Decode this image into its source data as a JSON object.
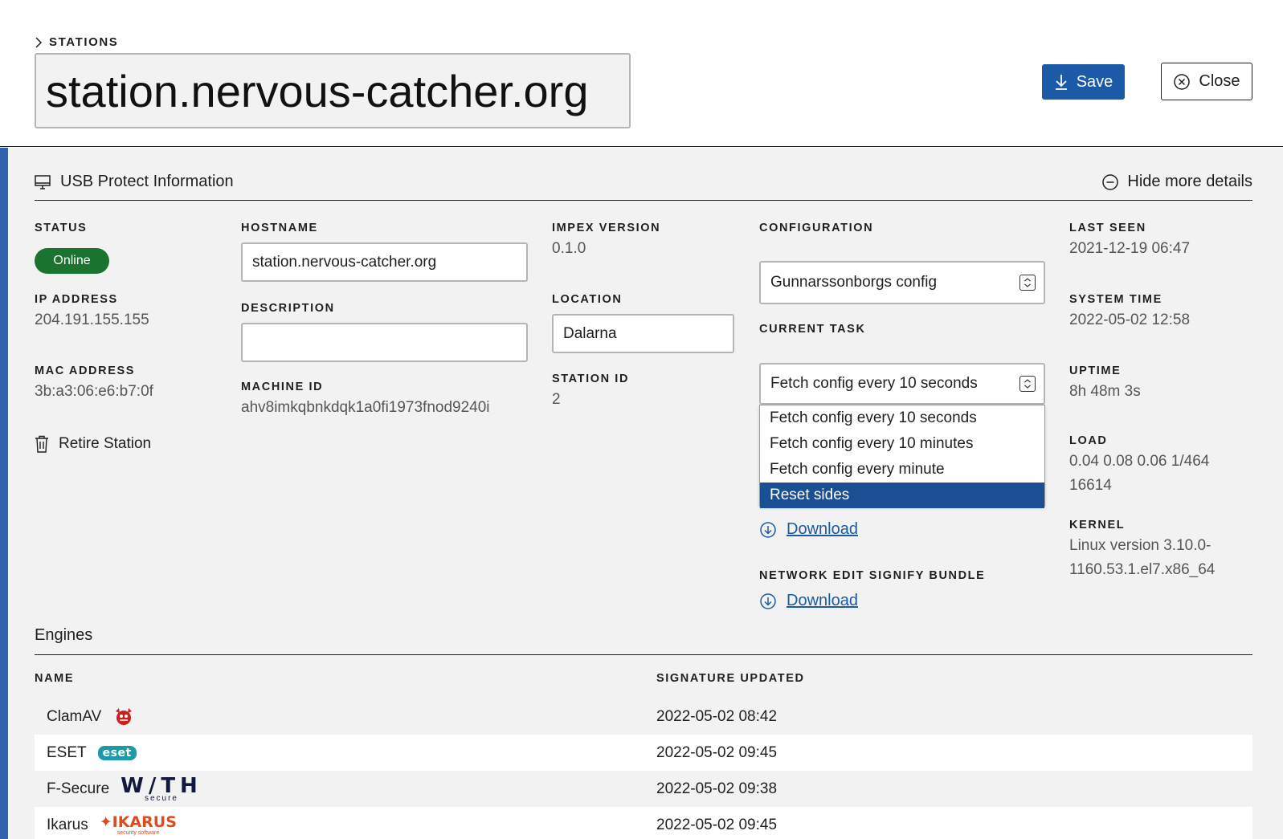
{
  "header": {
    "breadcrumb": "STATIONS",
    "title_value": "station.nervous-catcher.org",
    "save_label": "Save",
    "close_label": "Close"
  },
  "info": {
    "section_title": "USB Protect Information",
    "hide_details_label": "Hide more details",
    "status_label": "STATUS",
    "status_value": "Online",
    "ip_label": "IP ADDRESS",
    "ip_value": "204.191.155.155",
    "mac_label": "MAC ADDRESS",
    "mac_value": "3b:a3:06:e6:b7:0f",
    "retire_label": "Retire Station",
    "hostname_label": "HOSTNAME",
    "hostname_value": "station.nervous-catcher.org",
    "description_label": "DESCRIPTION",
    "description_value": "",
    "machine_id_label": "MACHINE ID",
    "machine_id_value": "ahv8imkqbnkdqk1a0fi1973fnod9240i",
    "impex_label": "IMPEX VERSION",
    "impex_value": "0.1.0",
    "location_label": "LOCATION",
    "location_value": "Dalarna",
    "station_id_label": "STATION ID",
    "station_id_value": "2",
    "configuration_label": "CONFIGURATION",
    "configuration_value": "Gunnarssonborgs config",
    "current_task_label": "CURRENT TASK",
    "current_task_value": "Fetch config every 10 seconds",
    "task_options": [
      "Fetch config every 10 seconds",
      "Fetch config every 10 minutes",
      "Fetch config every minute",
      "Reset sides"
    ],
    "download_label": "Download",
    "network_bundle_label": "NETWORK EDIT SIGNIFY BUNDLE",
    "network_download_label": "Download",
    "last_seen_label": "LAST SEEN",
    "last_seen_value": "2021-12-19 06:47",
    "system_time_label": "SYSTEM TIME",
    "system_time_value": "2022-05-02 12:58",
    "uptime_label": "UPTIME",
    "uptime_value": "8h 48m 3s",
    "load_label": "LOAD",
    "load_value_1": "0.04 0.08 0.06 1/464",
    "load_value_2": "16614",
    "kernel_label": "KERNEL",
    "kernel_value_1": "Linux version 3.10.0-",
    "kernel_value_2": "1160.53.1.el7.x86_64"
  },
  "engines": {
    "section_title": "Engines",
    "col_name": "NAME",
    "col_signature": "SIGNATURE UPDATED",
    "rows": [
      {
        "name": "ClamAV",
        "date": "2022-05-02 08:42",
        "logo": "clamav-logo"
      },
      {
        "name": "ESET",
        "date": "2022-05-02 09:45",
        "logo": "eset-logo",
        "logo_text": "eset"
      },
      {
        "name": "F-Secure",
        "date": "2022-05-02 09:38",
        "logo": "withsecure-logo",
        "logo_text": "W/TH",
        "logo_sub": "secure"
      },
      {
        "name": "Ikarus",
        "date": "2022-05-02 09:45",
        "logo": "ikarus-logo",
        "logo_text": "IKARUS",
        "logo_sub": "security software"
      }
    ]
  },
  "colors": {
    "accent": "#2f63ad",
    "primary_button": "#1b5aa6",
    "status_online": "#1a7430",
    "selected_option": "#1b4f94"
  }
}
